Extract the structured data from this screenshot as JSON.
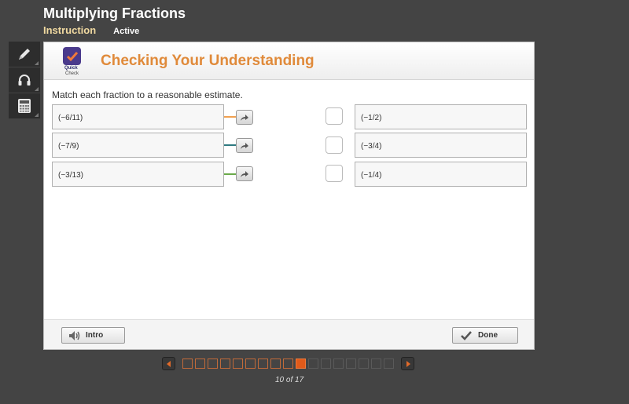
{
  "header": {
    "title": "Multiplying Fractions",
    "section": "Instruction",
    "status": "Active"
  },
  "toolbar": {
    "tools": [
      {
        "name": "pencil",
        "icon": "pencil-icon"
      },
      {
        "name": "audio",
        "icon": "headphones-icon"
      },
      {
        "name": "calculator",
        "icon": "calculator-icon"
      }
    ]
  },
  "panel": {
    "badge_line1": "Quick",
    "badge_line2": "Check",
    "title": "Checking Your Understanding",
    "instructions": "Match each fraction to a reasonable estimate.",
    "left_items": [
      {
        "label": "(−6/11)",
        "color": "#f0a050"
      },
      {
        "label": "(−7/9)",
        "color": "#2e7a80"
      },
      {
        "label": "(−3/13)",
        "color": "#6aaa4a"
      }
    ],
    "right_items": [
      {
        "label": "(−1/2)"
      },
      {
        "label": "(−3/4)"
      },
      {
        "label": "(−1/4)"
      }
    ],
    "intro_label": "Intro",
    "done_label": "Done"
  },
  "pager": {
    "current": 10,
    "total": 17,
    "label": "10 of 17",
    "accent": "#e05a1a"
  }
}
